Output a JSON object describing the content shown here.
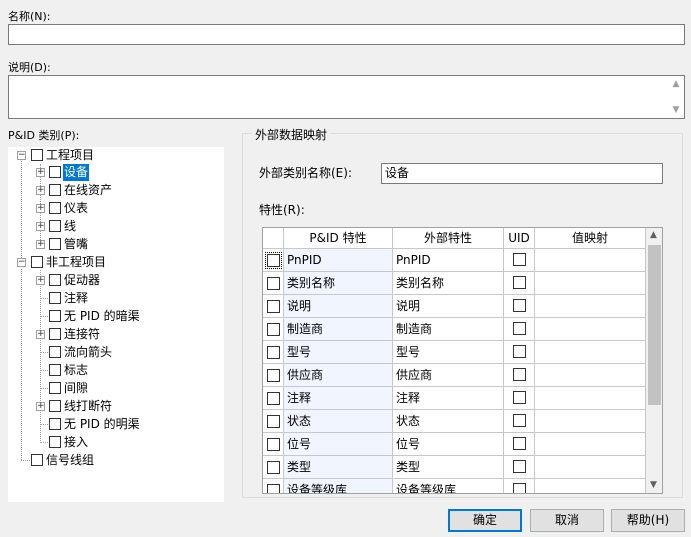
{
  "name": {
    "label": "名称(N):",
    "value": ""
  },
  "description": {
    "label": "说明(D):",
    "value": ""
  },
  "category": {
    "label": "P&ID 类别(P):",
    "tree": [
      {
        "label": "工程项目"
      },
      {
        "label": "设备"
      },
      {
        "label": "在线资产"
      },
      {
        "label": "仪表"
      },
      {
        "label": "线"
      },
      {
        "label": "管嘴"
      },
      {
        "label": "非工程项目"
      },
      {
        "label": "促动器"
      },
      {
        "label": "注释"
      },
      {
        "label": "无 PID 的暗渠"
      },
      {
        "label": "连接符"
      },
      {
        "label": "流向箭头"
      },
      {
        "label": "标志"
      },
      {
        "label": "间隙"
      },
      {
        "label": "线打断符"
      },
      {
        "label": "无 PID 的明渠"
      },
      {
        "label": "接入"
      },
      {
        "label": "信号线组"
      }
    ]
  },
  "mapping": {
    "title": "外部数据映射",
    "ext_class_label": "外部类别名称(E):",
    "ext_class_value": "设备",
    "props_label": "特性(R):",
    "columns": [
      "P&ID 特性",
      "外部特性",
      "UID",
      "值映射"
    ],
    "rows": [
      {
        "pid": "PnPID",
        "ext": "PnPID"
      },
      {
        "pid": "类别名称",
        "ext": "类别名称"
      },
      {
        "pid": "说明",
        "ext": "说明"
      },
      {
        "pid": "制造商",
        "ext": "制造商"
      },
      {
        "pid": "型号",
        "ext": "型号"
      },
      {
        "pid": "供应商",
        "ext": "供应商"
      },
      {
        "pid": "注释",
        "ext": "注释"
      },
      {
        "pid": "状态",
        "ext": "状态"
      },
      {
        "pid": "位号",
        "ext": "位号"
      },
      {
        "pid": "类型",
        "ext": "类型"
      },
      {
        "pid": "设备等级库",
        "ext": "设备等级库"
      }
    ]
  },
  "buttons": {
    "ok": "确定",
    "cancel": "取消",
    "help": "帮助(H)"
  },
  "colors": {
    "selection": "#0078d7",
    "default_button_border": "#0078d7"
  }
}
